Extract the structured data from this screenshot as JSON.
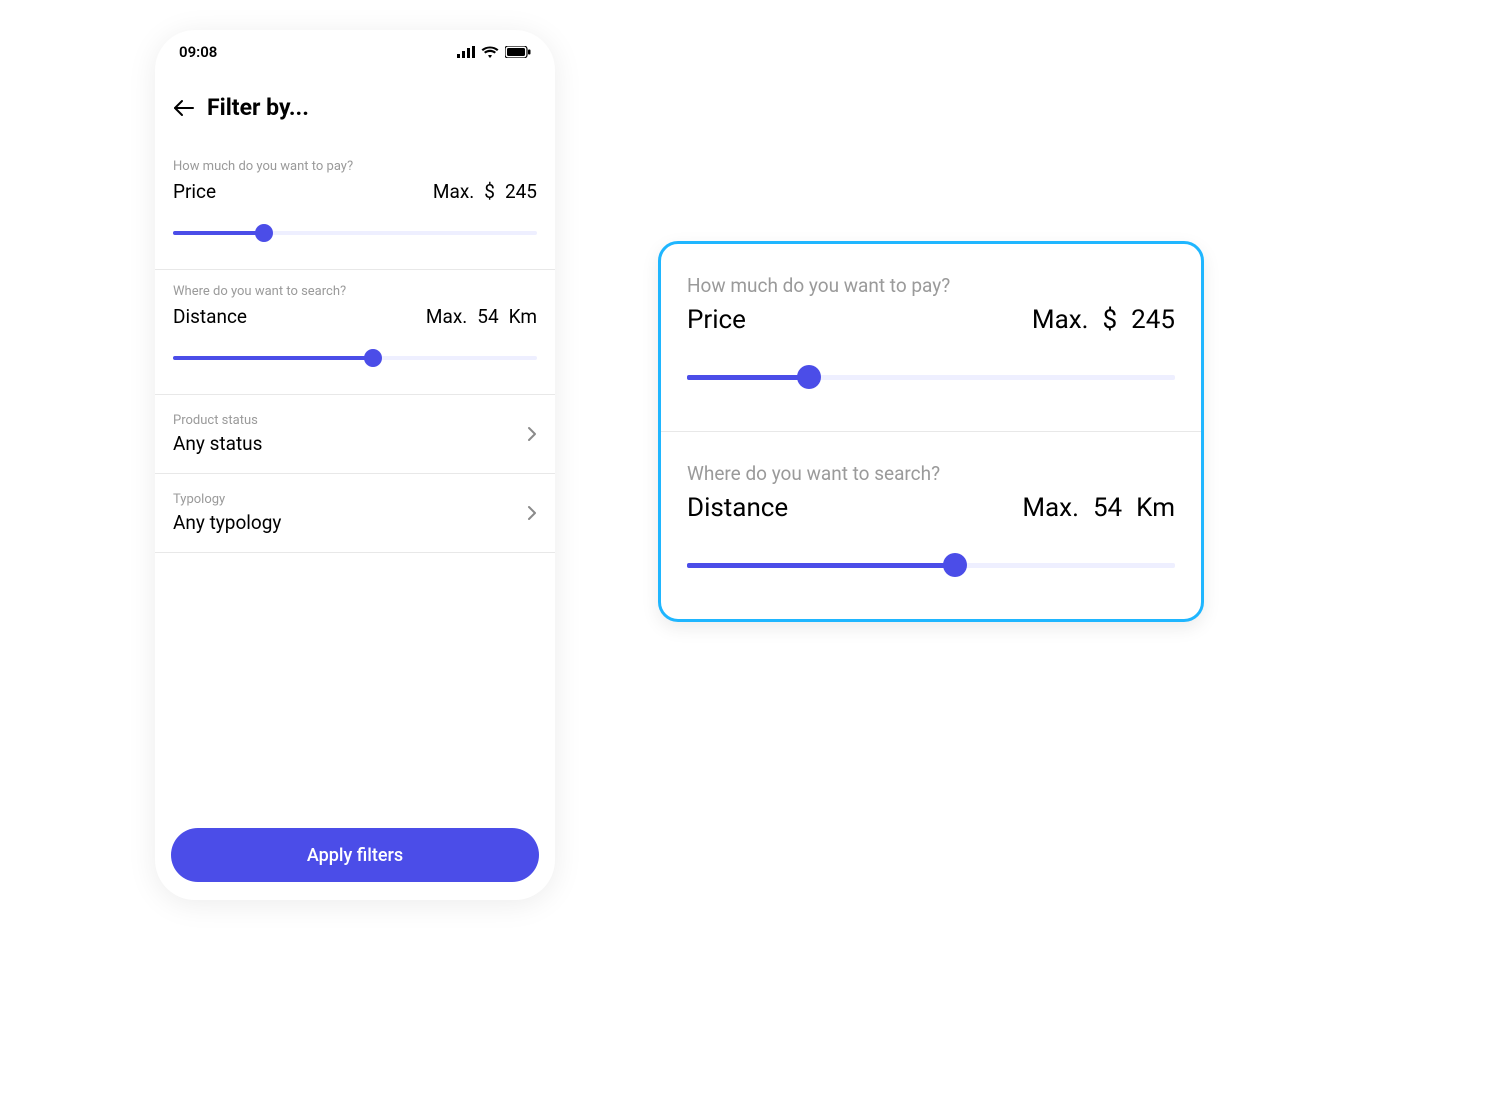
{
  "statusbar": {
    "time": "09:08"
  },
  "header": {
    "title": "Filter by..."
  },
  "price": {
    "hint": "How much do you want to pay?",
    "label": "Price",
    "max_label": "Max.",
    "currency": "$",
    "value": "245",
    "slider_percent": 25
  },
  "distance": {
    "hint": "Where do you want to search?",
    "label": "Distance",
    "max_label": "Max.",
    "value": "54",
    "unit": "Km",
    "slider_percent": 55
  },
  "status": {
    "hint": "Product status",
    "value": "Any status"
  },
  "typology": {
    "hint": "Typology",
    "value": "Any typology"
  },
  "footer": {
    "apply_label": "Apply filters"
  }
}
